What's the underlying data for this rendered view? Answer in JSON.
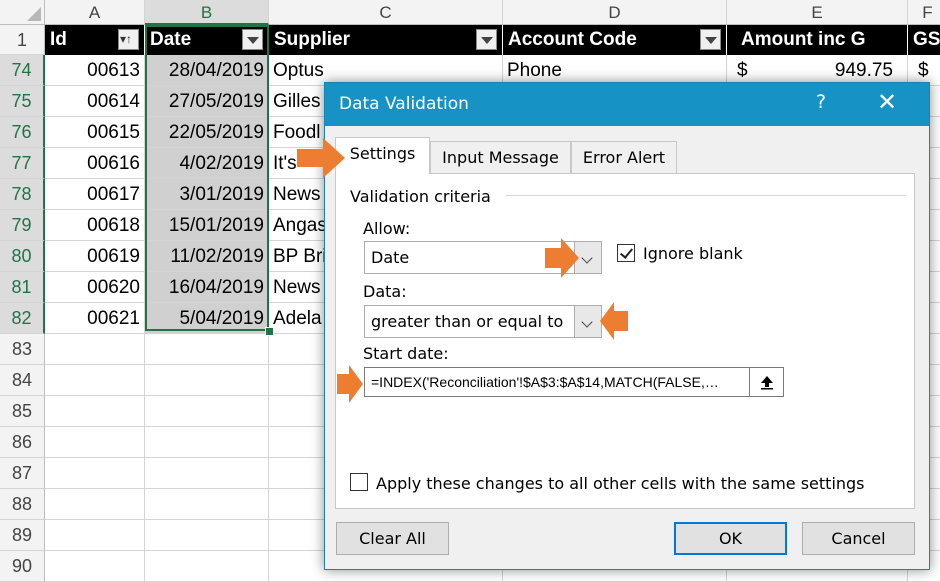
{
  "sheet": {
    "columns": [
      "A",
      "B",
      "C",
      "D",
      "E",
      "F"
    ],
    "headers": {
      "id": "Id",
      "date": "Date",
      "supplier": "Supplier",
      "account": "Account Code",
      "amount": "Amount inc G",
      "gst": "GS"
    },
    "rows": [
      {
        "num": "74",
        "id": "00613",
        "date": "28/04/2019",
        "supplier": "Optus",
        "account": "Phone",
        "amt_sym": "$",
        "amount": "949.75",
        "gst_sym": "$"
      },
      {
        "num": "75",
        "id": "00614",
        "date": "27/05/2019",
        "supplier": "Gilles",
        "account": "",
        "amt_sym": "",
        "amount": "",
        "gst_sym": ""
      },
      {
        "num": "76",
        "id": "00615",
        "date": "22/05/2019",
        "supplier": "Foodl",
        "account": "",
        "amt_sym": "",
        "amount": "",
        "gst_sym": ""
      },
      {
        "num": "77",
        "id": "00616",
        "date": "4/02/2019",
        "supplier": "It's",
        "account": "",
        "amt_sym": "",
        "amount": "",
        "gst_sym": ""
      },
      {
        "num": "78",
        "id": "00617",
        "date": "3/01/2019",
        "supplier": "News",
        "account": "",
        "amt_sym": "",
        "amount": "",
        "gst_sym": ""
      },
      {
        "num": "79",
        "id": "00618",
        "date": "15/01/2019",
        "supplier": "Angas",
        "account": "",
        "amt_sym": "",
        "amount": "",
        "gst_sym": ""
      },
      {
        "num": "80",
        "id": "00619",
        "date": "11/02/2019",
        "supplier": "BP Bri",
        "account": "",
        "amt_sym": "",
        "amount": "",
        "gst_sym": ""
      },
      {
        "num": "81",
        "id": "00620",
        "date": "16/04/2019",
        "supplier": "News",
        "account": "",
        "amt_sym": "",
        "amount": "",
        "gst_sym": ""
      },
      {
        "num": "82",
        "id": "00621",
        "date": "5/04/2019",
        "supplier": "Adela",
        "account": "",
        "amt_sym": "",
        "amount": "",
        "gst_sym": ""
      }
    ],
    "empty_rows": [
      "83",
      "84",
      "85",
      "86",
      "87",
      "88",
      "89",
      "90"
    ],
    "header_row_num": "1"
  },
  "dialog": {
    "title": "Data Validation",
    "help": "?",
    "close": "✕",
    "tabs": [
      "Settings",
      "Input Message",
      "Error Alert"
    ],
    "group_label": "Validation criteria",
    "allow_label": "Allow:",
    "allow_value": "Date",
    "ignore_blank_label": "Ignore blank",
    "ignore_blank_checked": true,
    "data_label": "Data:",
    "data_value": "greater than or equal to",
    "start_label": "Start date:",
    "start_value": "=INDEX('Reconciliation'!$A$3:$A$14,MATCH(FALSE,…",
    "apply_label": "Apply these changes to all other cells with the same settings",
    "apply_checked": false,
    "buttons": {
      "clear": "Clear All",
      "ok": "OK",
      "cancel": "Cancel"
    }
  },
  "colors": {
    "accent": "#1692c4",
    "excel_green": "#217346",
    "callout": "#ed7d31"
  }
}
